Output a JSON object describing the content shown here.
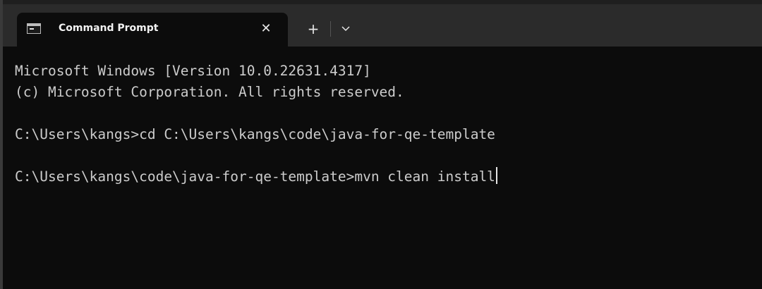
{
  "window": {
    "tab": {
      "icon": "command-prompt-icon",
      "title": "Command Prompt",
      "close_glyph": "✕"
    },
    "new_tab_glyph": "+",
    "dropdown_icon": "chevron-down-icon"
  },
  "terminal": {
    "lines": [
      "Microsoft Windows [Version 10.0.22631.4317]",
      "(c) Microsoft Corporation. All rights reserved.",
      "",
      "C:\\Users\\kangs>cd C:\\Users\\kangs\\code\\java-for-qe-template",
      "",
      "C:\\Users\\kangs\\code\\java-for-qe-template>mvn clean install"
    ]
  },
  "colors": {
    "background": "#0c0c0c",
    "titlebar": "#2b2b2b",
    "text": "#cccccc"
  }
}
